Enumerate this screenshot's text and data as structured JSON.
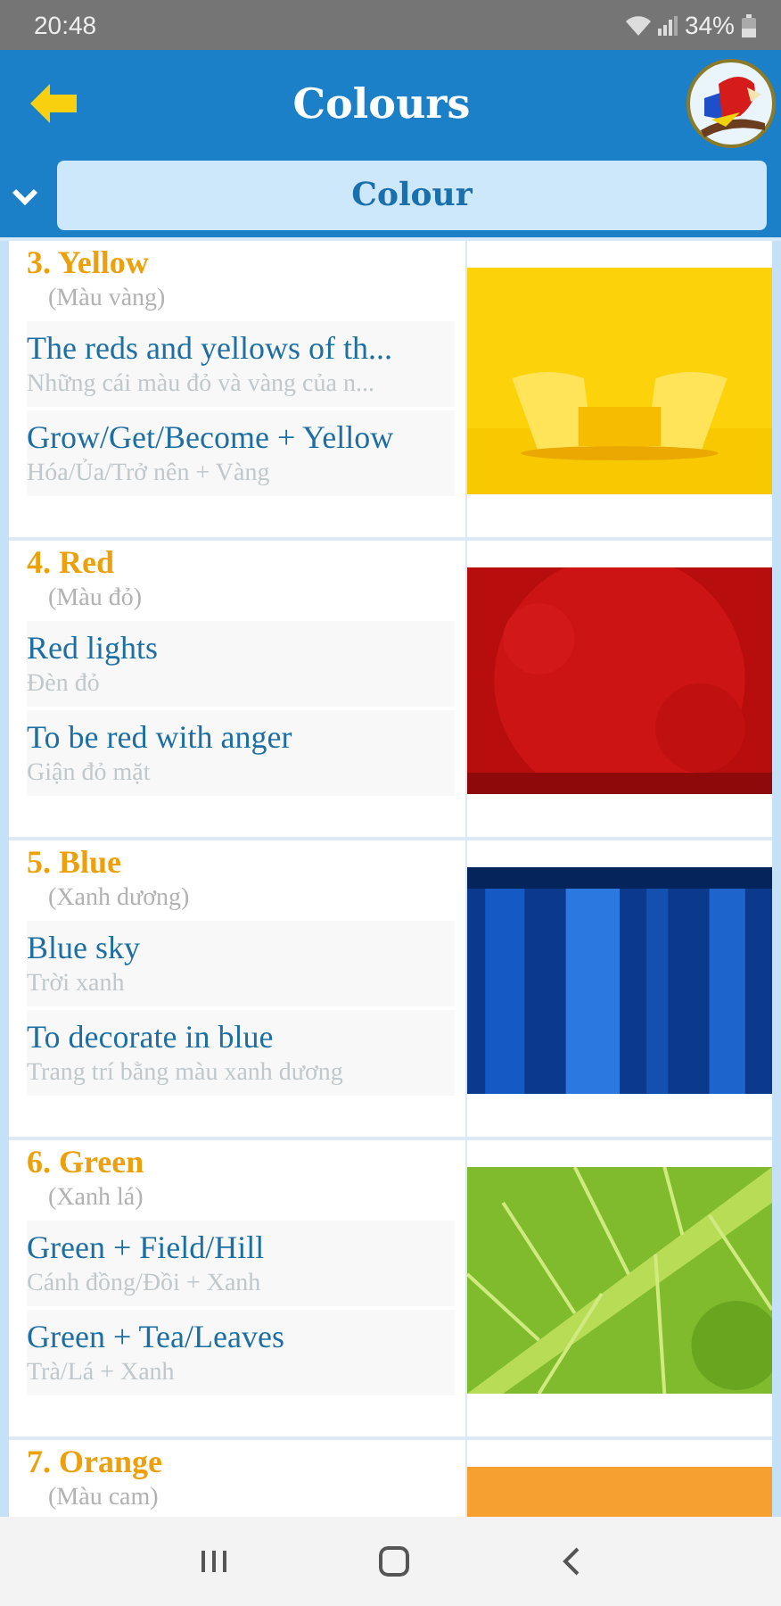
{
  "status_bar": {
    "time": "20:48",
    "battery": "34%"
  },
  "header": {
    "title": "Colours"
  },
  "dropdown": {
    "label": "Colour",
    "expanded": false
  },
  "sections": [
    {
      "title": "3. Yellow",
      "subtitle": "(Màu vàng)",
      "phrases": [
        {
          "en": "The reds and yellows of th...",
          "vi": "Những cái màu đỏ và vàng của n..."
        },
        {
          "en": "Grow/Get/Become + Yellow",
          "vi": "Hóa/Ủa/Trở nên + Vàng"
        }
      ]
    },
    {
      "title": "4. Red",
      "subtitle": "(Màu đỏ)",
      "phrases": [
        {
          "en": "Red lights",
          "vi": "Đèn đỏ"
        },
        {
          "en": "To be red with anger",
          "vi": "Giận đỏ mặt"
        }
      ]
    },
    {
      "title": "5. Blue",
      "subtitle": "(Xanh dương)",
      "phrases": [
        {
          "en": "Blue sky",
          "vi": "Trời xanh"
        },
        {
          "en": "To decorate in blue",
          "vi": "Trang trí bằng màu xanh dương"
        }
      ]
    },
    {
      "title": "6. Green",
      "subtitle": "(Xanh lá)",
      "phrases": [
        {
          "en": "Green + Field/Hill",
          "vi": "Cánh đồng/Đồi + Xanh"
        },
        {
          "en": "Green + Tea/Leaves",
          "vi": "Trà/Lá + Xanh"
        }
      ]
    },
    {
      "title": "7. Orange",
      "subtitle": "(Màu cam)"
    }
  ]
}
